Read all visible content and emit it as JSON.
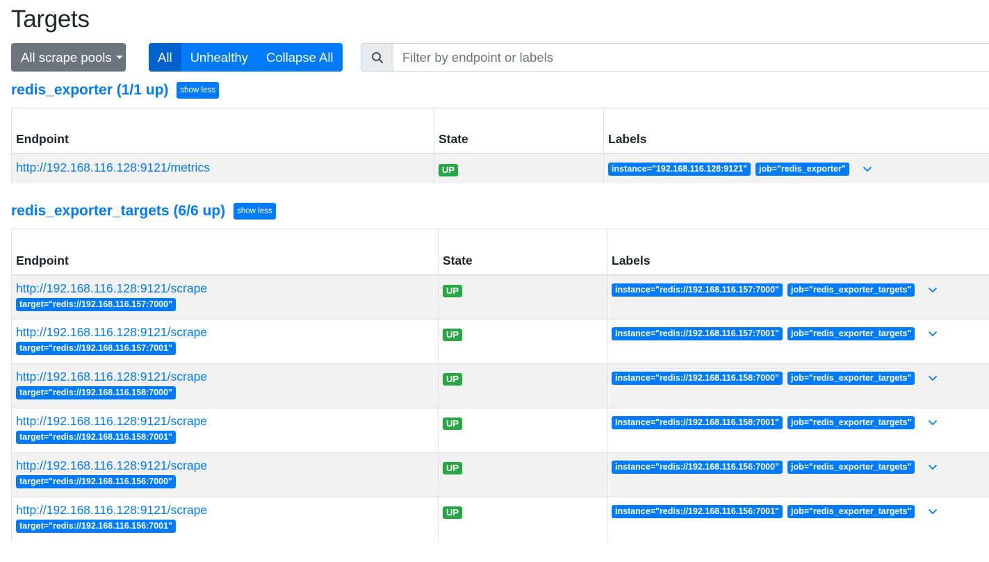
{
  "page": {
    "title": "Targets"
  },
  "controls": {
    "pools_label": "All scrape pools",
    "filters": [
      {
        "label": "All",
        "active": true
      },
      {
        "label": "Unhealthy",
        "active": false
      },
      {
        "label": "Collapse All",
        "active": false
      }
    ],
    "search_placeholder": "Filter by endpoint or labels",
    "search_icon": "search-icon"
  },
  "colors": {
    "primary": "#007bff",
    "secondary": "#6c757d",
    "success": "#28a745"
  },
  "pools": [
    {
      "title": "redis_exporter (1/1 up)",
      "toggle_label": "show less",
      "columns": [
        "Endpoint",
        "State",
        "Labels"
      ],
      "rows": [
        {
          "endpoint": "http://192.168.116.128:9121/metrics",
          "target": "",
          "state": "UP",
          "labels": [
            "instance=\"192.168.116.128:9121\"",
            "job=\"redis_exporter\""
          ]
        }
      ]
    },
    {
      "title": "redis_exporter_targets (6/6 up)",
      "toggle_label": "show less",
      "columns": [
        "Endpoint",
        "State",
        "Labels"
      ],
      "rows": [
        {
          "endpoint": "http://192.168.116.128:9121/scrape",
          "target": "target=\"redis://192.168.116.157:7000\"",
          "state": "UP",
          "labels": [
            "instance=\"redis://192.168.116.157:7000\"",
            "job=\"redis_exporter_targets\""
          ]
        },
        {
          "endpoint": "http://192.168.116.128:9121/scrape",
          "target": "target=\"redis://192.168.116.157:7001\"",
          "state": "UP",
          "labels": [
            "instance=\"redis://192.168.116.157:7001\"",
            "job=\"redis_exporter_targets\""
          ]
        },
        {
          "endpoint": "http://192.168.116.128:9121/scrape",
          "target": "target=\"redis://192.168.116.158:7000\"",
          "state": "UP",
          "labels": [
            "instance=\"redis://192.168.116.158:7000\"",
            "job=\"redis_exporter_targets\""
          ]
        },
        {
          "endpoint": "http://192.168.116.128:9121/scrape",
          "target": "target=\"redis://192.168.116.158:7001\"",
          "state": "UP",
          "labels": [
            "instance=\"redis://192.168.116.158:7001\"",
            "job=\"redis_exporter_targets\""
          ]
        },
        {
          "endpoint": "http://192.168.116.128:9121/scrape",
          "target": "target=\"redis://192.168.116.156:7000\"",
          "state": "UP",
          "labels": [
            "instance=\"redis://192.168.116.156:7000\"",
            "job=\"redis_exporter_targets\""
          ]
        },
        {
          "endpoint": "http://192.168.116.128:9121/scrape",
          "target": "target=\"redis://192.168.116.156:7001\"",
          "state": "UP",
          "labels": [
            "instance=\"redis://192.168.116.156:7001\"",
            "job=\"redis_exporter_targets\""
          ]
        }
      ]
    }
  ]
}
